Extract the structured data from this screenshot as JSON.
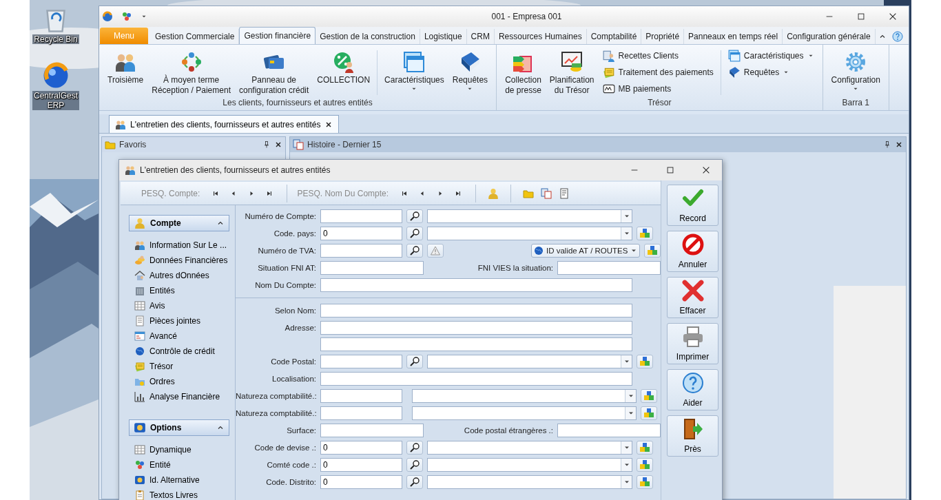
{
  "desktop": {
    "icons": [
      {
        "lines": [
          "Recycle Bin"
        ]
      },
      {
        "lines": [
          "CentralGest",
          "ERP"
        ]
      }
    ]
  },
  "window": {
    "title": "001 - Empresa 001"
  },
  "ribbon": {
    "tabs": [
      {
        "label": "Menu",
        "kind": "app",
        "selected": false
      },
      {
        "label": "Gestion Commerciale",
        "kind": "tab",
        "selected": false
      },
      {
        "label": "Gestion financière",
        "kind": "tab",
        "selected": true
      },
      {
        "label": "Gestion de la construction",
        "kind": "tab",
        "selected": false
      },
      {
        "label": "Logistique",
        "kind": "tab",
        "selected": false
      },
      {
        "label": "CRM",
        "kind": "tab",
        "selected": false
      },
      {
        "label": "Ressources Humaines",
        "kind": "tab",
        "selected": false
      },
      {
        "label": "Comptabilité",
        "kind": "tab",
        "selected": false
      },
      {
        "label": "Propriété",
        "kind": "tab",
        "selected": false
      },
      {
        "label": "Panneaux en temps réel",
        "kind": "tab",
        "selected": false
      },
      {
        "label": "Configuration générale",
        "kind": "tab",
        "selected": false
      }
    ],
    "groups": [
      {
        "label": "Les clients, fournisseurs et autres entités",
        "items": [
          {
            "kind": "large",
            "lines": [
              "Troisième"
            ],
            "dropdown": false
          },
          {
            "kind": "large",
            "lines": [
              "À moyen terme",
              "Réception / Paiement"
            ],
            "dropdown": false
          },
          {
            "kind": "large",
            "lines": [
              "Panneau de",
              "configuration crédit"
            ],
            "dropdown": false
          },
          {
            "kind": "large",
            "lines": [
              "COLLECTION"
            ],
            "dropdown": false
          },
          {
            "kind": "divider"
          },
          {
            "kind": "large",
            "lines": [
              "Caractéristiques"
            ],
            "dropdown": true
          },
          {
            "kind": "large",
            "lines": [
              "Requêtes"
            ],
            "dropdown": true
          }
        ]
      },
      {
        "label": "Trésor",
        "items": [
          {
            "kind": "large",
            "lines": [
              "Collection",
              "de presse"
            ],
            "dropdown": false
          },
          {
            "kind": "large",
            "lines": [
              "Planification",
              "du Trésor"
            ],
            "dropdown": false
          },
          {
            "kind": "stack",
            "items": [
              {
                "label": "Recettes Clients",
                "dropdown": false
              },
              {
                "label": "Traitement des paiements",
                "dropdown": false
              },
              {
                "label": "MB paiements",
                "dropdown": false
              }
            ]
          },
          {
            "kind": "divider"
          },
          {
            "kind": "stack",
            "items": [
              {
                "label": "Caractéristiques",
                "dropdown": true
              },
              {
                "label": "Requêtes",
                "dropdown": true
              }
            ]
          }
        ]
      },
      {
        "label": "Barra 1",
        "items": [
          {
            "kind": "large",
            "lines": [
              "Configuration"
            ],
            "dropdown": true
          }
        ]
      }
    ]
  },
  "document_tabs": [
    {
      "label": "L'entretien des clients, fournisseurs et autres entités",
      "selected": true
    }
  ],
  "panels": [
    {
      "title": "Favoris"
    },
    {
      "title": "Histoire - Dernier 15"
    }
  ],
  "dialog": {
    "title": "L'entretien des clients, fournisseurs et autres entités",
    "toolbar": {
      "search_account": "PESQ. Compte:",
      "search_name": "PESQ. Nom Du Compte:"
    },
    "nav": {
      "groups": [
        {
          "title": "Compte",
          "expanded": true,
          "items": [
            "Information Sur Le ...",
            "Données Financières",
            "Autres dOnnées",
            "Entités",
            "Avis",
            "Pièces jointes",
            "Avancé",
            "Contrôle de crédit",
            "Trésor",
            "Ordres",
            "Analyse Financière"
          ]
        },
        {
          "title": "Options",
          "expanded": true,
          "items": [
            "Dynamique",
            "Entité",
            "Id. Alternative",
            "Textos Livres"
          ]
        }
      ]
    },
    "form": {
      "sections": [
        {
          "rows": [
            {
              "label": "Numéro de Compte:",
              "kind": "lookup",
              "value": "",
              "cube": false
            },
            {
              "label": "Code. pays:",
              "kind": "lookup",
              "value": "0",
              "cube": true
            },
            {
              "label": "Numéro de TVA:",
              "kind": "tva",
              "select": "ID valide AT / ROUTES",
              "cube": true
            },
            {
              "label": "Situation FNI AT:",
              "kind": "pair",
              "label2": "FNI VIES la situation:"
            },
            {
              "label": "Nom Du Compte:",
              "kind": "text"
            }
          ]
        },
        {
          "rows": [
            {
              "label": "Selon Nom:",
              "kind": "text"
            },
            {
              "label": "Adresse:",
              "kind": "address"
            },
            {
              "label": "Code Postal:",
              "kind": "lookup",
              "value": "",
              "cube": true
            },
            {
              "label": "Localisation:",
              "kind": "text"
            },
            {
              "label": "Natureza comptabilité.:",
              "kind": "select",
              "cube": true
            },
            {
              "label": "Natureza comptabilité.:",
              "kind": "select",
              "cube": true
            },
            {
              "label": "Surface:",
              "kind": "pair",
              "label2": "Code postal étrangères .:"
            },
            {
              "label": "Code de devise .:",
              "kind": "lookup",
              "value": "0",
              "cube": true
            },
            {
              "label": "Comté code .:",
              "kind": "lookup",
              "value": "0",
              "cube": true
            },
            {
              "label": "Code. Distrito:",
              "kind": "lookup",
              "value": "0",
              "cube": true
            }
          ]
        }
      ]
    },
    "actions": [
      "Record",
      "Annuler",
      "Effacer",
      "Imprimer",
      "Aider",
      "Près"
    ]
  }
}
